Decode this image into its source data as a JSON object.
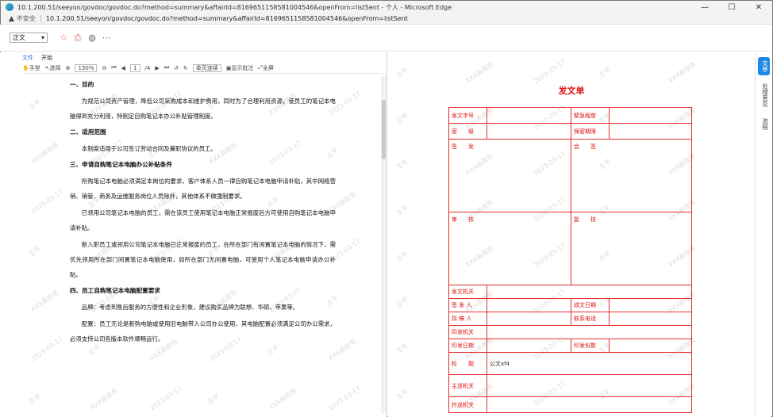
{
  "window": {
    "title": "10.1.200.51/seeyon/govdoc/govdoc.do?method=summary&affairId=8169651158581004546&openFrom=listSent - 个人 - Microsoft Edge",
    "insecure_label": "不安全",
    "url": "10.1.200.51/seeyon/govdoc/govdoc.do?method=summary&affairId=8169651158581004546&openFrom=listSent",
    "minimize": "—",
    "maximize": "☐",
    "close": "✕"
  },
  "toolbar": {
    "view_select": "正文"
  },
  "pdf": {
    "menu": [
      "文件",
      "开始"
    ],
    "tools": {
      "hand": "手型",
      "select": "选择",
      "zoom": "130%",
      "page_current": "1",
      "page_total": "/4",
      "mode": "单页连续",
      "show_comments": "显示批注",
      "fullscreen": "全屏"
    },
    "doc": {
      "s1_title": "一、目的",
      "s1_p1": "为规范公司资产管理，降低公司采购成本和维护费用，同时为了合理利用资源，使员工的笔记本电脑得到充分利用，特制定自购笔记本办公补贴管理制度。",
      "s2_title": "二、适用范围",
      "s2_p1": "本制度适用于公司签订劳动合同及兼职协议的员工。",
      "s3_title": "三、申请自购笔记本电脑办公补贴条件",
      "s3_p1": "所购笔记本电脑必须满足本岗位的要求，客户体系人员一律自购笔记本电脑申请补贴，其中网络营销、销管、商务及运维服务岗位人员除外，其他体系不做强制要求。",
      "s3_p2": "已领用公司笔记本电脑的员工，需在该员工使用笔记本电脑正常报废后方可使用自购笔记本电脑申请补贴。",
      "s3_p3": "新入职员工或领用公司笔记本电脑已正常报废的员工，在所在部门有闲置笔记本电脑的情况下，需优先领用所在部门闲置笔记本电脑使用，如所在部门无闲置电脑，可使用个人笔记本电脑申请办公补贴。",
      "s4_title": "四、员工自购笔记本电脑配置要求",
      "s4_p1": "品牌：考虑到售后服务的方便性和企业形象，建议购买品牌为联想、华硕、苹果等。",
      "s4_p2": "配置：员工无论是新购电脑或使用旧电脑带入公司办公使用，其电脑配置必须满足公司办公需求，必须支持公司各版本软件顺畅运行。"
    }
  },
  "form": {
    "title": "发文单",
    "doc_no": "发文字号",
    "urgency": "緊急程度",
    "secret": "密　　级",
    "secret_period": "保密期限",
    "signer": "签　　发",
    "countersign": "会　　签",
    "review": "审　　核",
    "review2": "复　　核",
    "issuing_org": "发文机关",
    "drafter": "签 发 人",
    "done_date": "成文日期",
    "preparer": "拟 稿 人",
    "contact": "联系电话",
    "print_org": "印发机关",
    "print_date": "印发日期",
    "print_copies": "印发份数",
    "subject": "标　　题",
    "subject_value": "公文xf4",
    "main_send": "主送机关",
    "copy_send": "抄送机关"
  },
  "side_tabs": [
    "文单",
    "处理意见",
    "流程"
  ],
  "watermark": {
    "name": "王平",
    "org": "XXX县政务",
    "date": "2023-03-17"
  },
  "colors": {
    "form_red": "#e01010",
    "accent_blue": "#1e88e5"
  }
}
